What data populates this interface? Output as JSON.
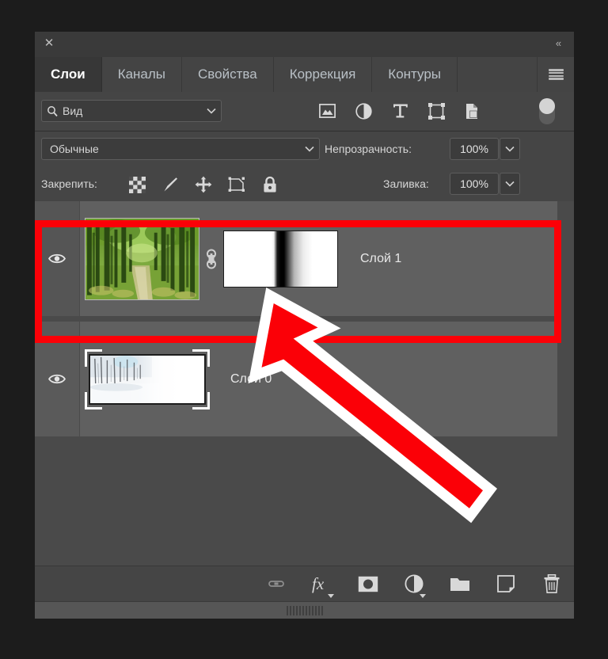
{
  "panel": {
    "title_close_icon": "close-icon",
    "collapse_icon": "collapse-double-arrow-icon",
    "menu_icon": "hamburger-menu-icon"
  },
  "tabs": [
    {
      "label": "Слои",
      "active": true
    },
    {
      "label": "Каналы",
      "active": false
    },
    {
      "label": "Свойства",
      "active": false
    },
    {
      "label": "Коррекция",
      "active": false
    },
    {
      "label": "Контуры",
      "active": false
    }
  ],
  "filter": {
    "value": "Вид",
    "search_icon": "search-icon",
    "chevron_icon": "chevron-down-icon",
    "icons": [
      {
        "name": "pixel-layer-filter-icon",
        "title": "Пиксели"
      },
      {
        "name": "adjustment-layer-filter-icon",
        "title": "Корректирующие"
      },
      {
        "name": "type-layer-filter-icon",
        "title": "Текст"
      },
      {
        "name": "shape-layer-filter-icon",
        "title": "Фигуры"
      },
      {
        "name": "smart-object-filter-icon",
        "title": "Смарт-объекты"
      }
    ],
    "toggle_name": "filter-enable-toggle",
    "toggle_on": true
  },
  "blend": {
    "mode": "Обычные",
    "opacity_label": "Непрозрачность:",
    "opacity_value": "100%",
    "chevron_icon": "chevron-down-icon"
  },
  "lock": {
    "label": "Закрепить:",
    "icons": [
      {
        "name": "lock-transparent-pixels-icon"
      },
      {
        "name": "lock-image-pixels-icon"
      },
      {
        "name": "lock-position-icon"
      },
      {
        "name": "lock-artboard-nesting-icon"
      },
      {
        "name": "lock-all-icon"
      }
    ],
    "fill_label": "Заливка:",
    "fill_value": "100%",
    "chevron_icon": "chevron-down-icon"
  },
  "layers": [
    {
      "name": "Слой 1",
      "visible": true,
      "selected": true,
      "thumbnail": "forest-path-photo",
      "link_icon": "link-mask-icon",
      "mask": "gradient-layer-mask"
    },
    {
      "name": "Слой 0",
      "visible": true,
      "selected": false,
      "thumbnail": "snowy-forest-photo"
    }
  ],
  "bottom_toolbar": [
    {
      "name": "link-layers-icon",
      "caret": false
    },
    {
      "name": "layer-style-fx-icon",
      "caret": true
    },
    {
      "name": "add-layer-mask-icon",
      "caret": false
    },
    {
      "name": "new-adjustment-layer-icon",
      "caret": true
    },
    {
      "name": "new-group-icon",
      "caret": false
    },
    {
      "name": "new-layer-icon",
      "caret": false
    },
    {
      "name": "delete-layer-icon",
      "caret": false
    }
  ],
  "annotation": {
    "highlight_color": "#fb0007",
    "arrow_color": "#fb0007",
    "arrow_outline": "#ffffff",
    "target": "gradient-layer-mask"
  },
  "colors": {
    "panel_bg": "#4a4a4a",
    "row_bg": "#454545",
    "layer_row_bg": "#606060",
    "tab_active_bg": "#373737",
    "text": "#d6d6d6"
  }
}
